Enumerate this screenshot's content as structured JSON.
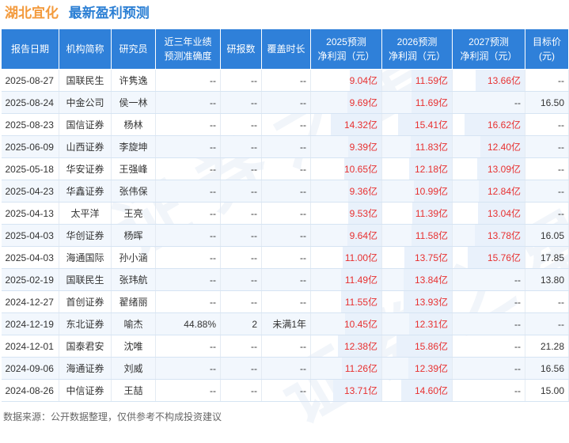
{
  "header": {
    "company": "湖北宜化",
    "section": "最新盈利预测"
  },
  "columns": [
    "报告日期",
    "机构简称",
    "研究员",
    "近三年业绩\n预测准确度",
    "研报数",
    "覆盖时长",
    "2025预测\n净利润（元）",
    "2026预测\n净利润（元）",
    "2027预测\n净利润（元）",
    "目标价\n(元)"
  ],
  "rows": [
    {
      "date": "2025-08-27",
      "inst": "国联民生",
      "analyst": "许隽逸",
      "acc": "--",
      "reports": "--",
      "coverage": "--",
      "p2025": "9.04亿",
      "p2026": "11.59亿",
      "p2027": "13.66亿",
      "target": "--"
    },
    {
      "date": "2025-08-24",
      "inst": "中金公司",
      "analyst": "侯一林",
      "acc": "--",
      "reports": "--",
      "coverage": "--",
      "p2025": "9.69亿",
      "p2026": "11.69亿",
      "p2027": "--",
      "target": "16.50"
    },
    {
      "date": "2025-08-23",
      "inst": "国信证券",
      "analyst": "杨林",
      "acc": "--",
      "reports": "--",
      "coverage": "--",
      "p2025": "14.32亿",
      "p2026": "15.41亿",
      "p2027": "16.62亿",
      "target": "--"
    },
    {
      "date": "2025-06-09",
      "inst": "山西证券",
      "analyst": "李旋坤",
      "acc": "--",
      "reports": "--",
      "coverage": "--",
      "p2025": "9.39亿",
      "p2026": "11.83亿",
      "p2027": "12.40亿",
      "target": "--"
    },
    {
      "date": "2025-05-18",
      "inst": "华安证券",
      "analyst": "王强峰",
      "acc": "--",
      "reports": "--",
      "coverage": "--",
      "p2025": "10.65亿",
      "p2026": "12.18亿",
      "p2027": "13.09亿",
      "target": "--"
    },
    {
      "date": "2025-04-23",
      "inst": "华鑫证券",
      "analyst": "张伟保",
      "acc": "--",
      "reports": "--",
      "coverage": "--",
      "p2025": "9.36亿",
      "p2026": "10.99亿",
      "p2027": "12.84亿",
      "target": "--"
    },
    {
      "date": "2025-04-13",
      "inst": "太平洋",
      "analyst": "王亮",
      "acc": "--",
      "reports": "--",
      "coverage": "--",
      "p2025": "9.53亿",
      "p2026": "11.39亿",
      "p2027": "13.04亿",
      "target": "--"
    },
    {
      "date": "2025-04-03",
      "inst": "华创证券",
      "analyst": "杨晖",
      "acc": "--",
      "reports": "--",
      "coverage": "--",
      "p2025": "9.64亿",
      "p2026": "11.58亿",
      "p2027": "13.78亿",
      "target": "16.05"
    },
    {
      "date": "2025-04-03",
      "inst": "海通国际",
      "analyst": "孙小涵",
      "acc": "--",
      "reports": "--",
      "coverage": "--",
      "p2025": "11.00亿",
      "p2026": "13.75亿",
      "p2027": "15.76亿",
      "target": "17.85"
    },
    {
      "date": "2025-02-19",
      "inst": "国联民生",
      "analyst": "张玮航",
      "acc": "--",
      "reports": "--",
      "coverage": "--",
      "p2025": "11.49亿",
      "p2026": "13.84亿",
      "p2027": "--",
      "target": "13.80"
    },
    {
      "date": "2024-12-27",
      "inst": "首创证券",
      "analyst": "翟绪丽",
      "acc": "--",
      "reports": "--",
      "coverage": "--",
      "p2025": "11.55亿",
      "p2026": "13.93亿",
      "p2027": "--",
      "target": "--"
    },
    {
      "date": "2024-12-19",
      "inst": "东北证券",
      "analyst": "喻杰",
      "acc": "44.88%",
      "reports": "2",
      "coverage": "未满1年",
      "p2025": "10.45亿",
      "p2026": "12.31亿",
      "p2027": "--",
      "target": "--"
    },
    {
      "date": "2024-12-01",
      "inst": "国泰君安",
      "analyst": "沈唯",
      "acc": "--",
      "reports": "--",
      "coverage": "--",
      "p2025": "12.38亿",
      "p2026": "15.86亿",
      "p2027": "--",
      "target": "21.28"
    },
    {
      "date": "2024-09-06",
      "inst": "海通证券",
      "analyst": "刘威",
      "acc": "--",
      "reports": "--",
      "coverage": "--",
      "p2025": "11.26亿",
      "p2026": "12.39亿",
      "p2027": "--",
      "target": "16.56"
    },
    {
      "date": "2024-08-26",
      "inst": "中信证券",
      "analyst": "王喆",
      "acc": "--",
      "reports": "--",
      "coverage": "--",
      "p2025": "13.71亿",
      "p2026": "14.60亿",
      "p2027": "--",
      "target": "15.00"
    }
  ],
  "footer": "数据来源：公开数据整理，仅供参考不构成投资建议",
  "colors": {
    "header_bg": "#2f80d9",
    "profit_red": "#e83030",
    "company_orange": "#f39a3c",
    "section_blue": "#2b7fd4"
  }
}
